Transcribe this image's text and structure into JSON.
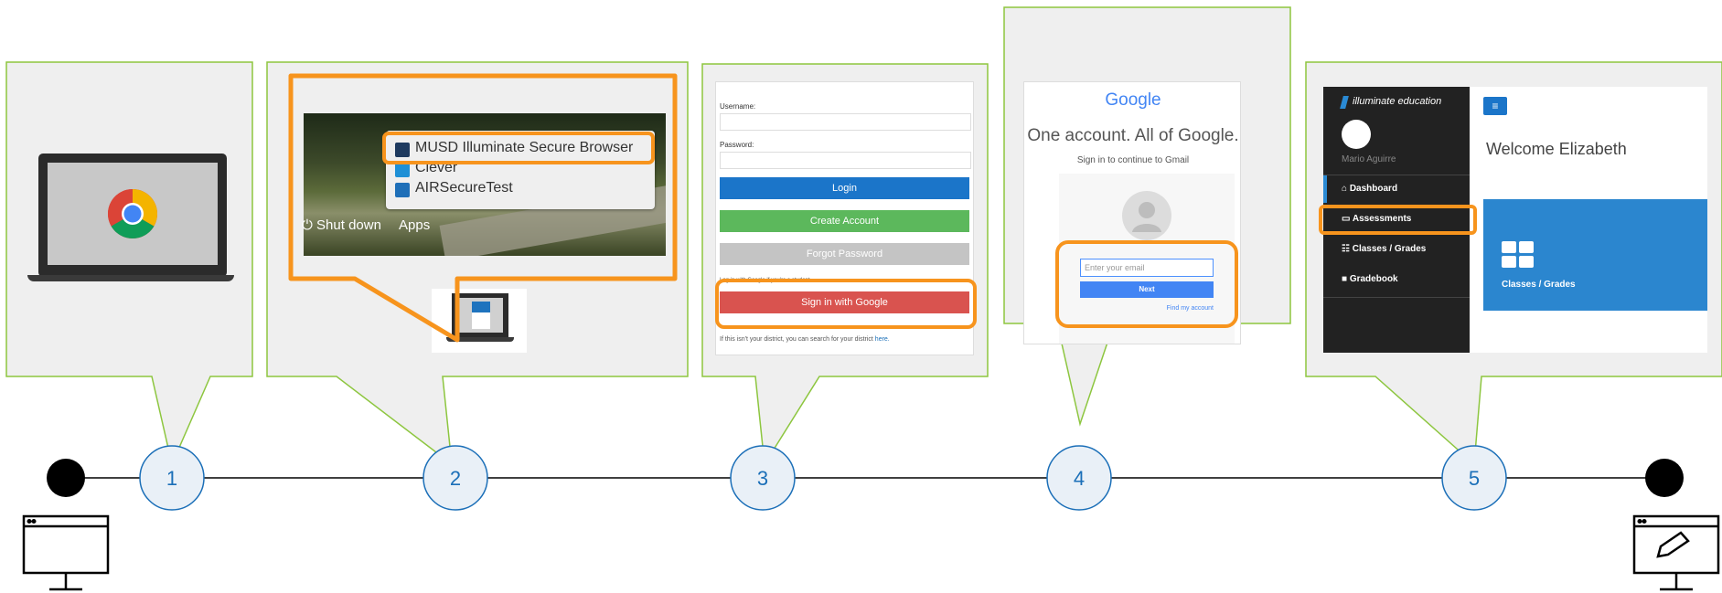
{
  "colors": {
    "panel_fill": "#efefef",
    "panel_border": "#8dc63f",
    "highlight": "#f7941d",
    "step_circle_fill": "#e9f0f7",
    "step_circle_stroke": "#1b6fb8",
    "timeline": "#000000"
  },
  "icons": {
    "start": "desktop-monitor-icon",
    "end": "edit-monitor-icon",
    "browser": "chrome-icon"
  },
  "steps": [
    {
      "label": "1"
    },
    {
      "label": "2"
    },
    {
      "label": "3"
    },
    {
      "label": "4"
    },
    {
      "label": "5"
    }
  ],
  "panel2": {
    "menu": [
      "MUSD Illuminate Secure Browser",
      "Clever",
      "AIRSecureTest"
    ],
    "shutdown": "Shut down",
    "apps": "Apps"
  },
  "panel3": {
    "username_label": "Username:",
    "password_label": "Password:",
    "login": "Login",
    "create_account": "Create Account",
    "forgot_password": "Forgot Password",
    "google_note": "Log in with Google if you're a student.",
    "signin_google": "Sign in with Google",
    "district_note": "If this isn't your district, you can search for your district",
    "district_link": "here."
  },
  "panel4": {
    "logo": "Google",
    "headline": "One account. All of Google.",
    "subline": "Sign in to continue to Gmail",
    "email_placeholder": "Enter your email",
    "next": "Next",
    "find_account": "Find my account"
  },
  "panel5": {
    "brand": "illuminate education",
    "user": "Mario Aguirre",
    "welcome": "Welcome Elizabeth",
    "nav": [
      "Dashboard",
      "Assessments",
      "Classes / Grades",
      "Gradebook"
    ],
    "tile": "Classes / Grades"
  }
}
